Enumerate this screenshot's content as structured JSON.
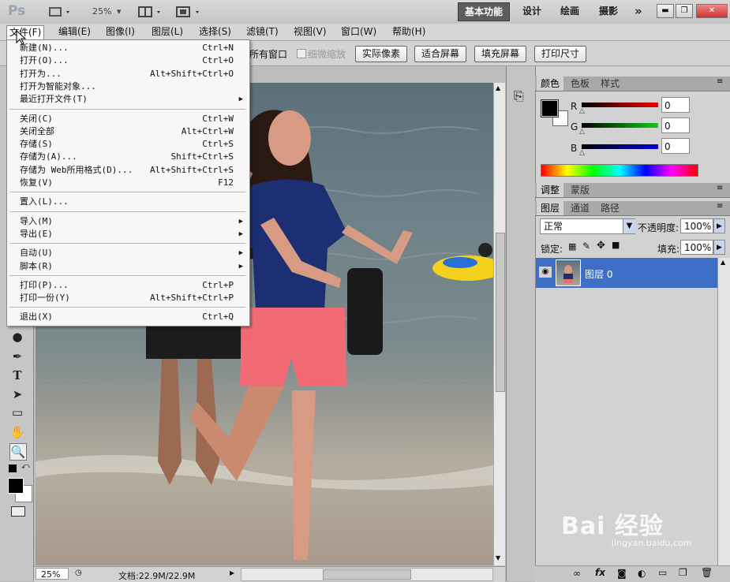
{
  "app": {
    "logo": "Ps",
    "zoom_label": "25%",
    "workspaces": [
      "基本功能",
      "设计",
      "绘画",
      "摄影"
    ],
    "more": "»"
  },
  "window_buttons": {
    "minimize": "▬",
    "restore": "❐",
    "close": "✕"
  },
  "menubar": [
    "文件(F)",
    "编辑(E)",
    "图像(I)",
    "图层(L)",
    "选择(S)",
    "滤镜(T)",
    "视图(V)",
    "窗口(W)",
    "帮助(H)"
  ],
  "options": {
    "all_windows": "所有窗口",
    "scrubby_zoom": "细微缩放",
    "buttons": [
      "实际像素",
      "适合屏幕",
      "填充屏幕",
      "打印尺寸"
    ]
  },
  "file_menu": [
    {
      "label": "新建(N)...",
      "shortcut": "Ctrl+N"
    },
    {
      "label": "打开(O)...",
      "shortcut": "Ctrl+O"
    },
    {
      "label": "打开为...",
      "shortcut": "Alt+Shift+Ctrl+O"
    },
    {
      "label": "打开为智能对象...",
      "shortcut": ""
    },
    {
      "label": "最近打开文件(T)",
      "shortcut": "",
      "submenu": true
    },
    {
      "sep": true
    },
    {
      "label": "关闭(C)",
      "shortcut": "Ctrl+W"
    },
    {
      "label": "关闭全部",
      "shortcut": "Alt+Ctrl+W"
    },
    {
      "label": "存储(S)",
      "shortcut": "Ctrl+S"
    },
    {
      "label": "存储为(A)...",
      "shortcut": "Shift+Ctrl+S"
    },
    {
      "label": "存储为 Web所用格式(D)...",
      "shortcut": "Alt+Shift+Ctrl+S"
    },
    {
      "label": "恢复(V)",
      "shortcut": "F12"
    },
    {
      "sep": true
    },
    {
      "label": "置入(L)...",
      "shortcut": ""
    },
    {
      "sep": true
    },
    {
      "label": "导入(M)",
      "shortcut": "",
      "submenu": true
    },
    {
      "label": "导出(E)",
      "shortcut": "",
      "submenu": true
    },
    {
      "sep": true
    },
    {
      "label": "自动(U)",
      "shortcut": "",
      "submenu": true
    },
    {
      "label": "脚本(R)",
      "shortcut": "",
      "submenu": true
    },
    {
      "sep": true
    },
    {
      "label": "打印(P)...",
      "shortcut": "Ctrl+P"
    },
    {
      "label": "打印一份(Y)",
      "shortcut": "Alt+Shift+Ctrl+P"
    },
    {
      "sep": true
    },
    {
      "label": "退出(X)",
      "shortcut": "Ctrl+Q"
    }
  ],
  "color_panel": {
    "tabs": [
      "颜色",
      "色板",
      "样式"
    ],
    "channels": [
      {
        "label": "R",
        "value": "0",
        "color": "#cc0000"
      },
      {
        "label": "G",
        "value": "0",
        "color": "#22b022"
      },
      {
        "label": "B",
        "value": "0",
        "color": "#0000cc"
      }
    ]
  },
  "adjust_panel": {
    "tabs": [
      "调整",
      "蒙版"
    ]
  },
  "layers_panel": {
    "tabs": [
      "图层",
      "通道",
      "路径"
    ],
    "blend_mode": "正常",
    "opacity_label": "不透明度:",
    "opacity_value": "100%",
    "lock_label": "锁定:",
    "fill_label": "填充:",
    "fill_value": "100%",
    "layer_name": "图层 0"
  },
  "status": {
    "zoom": "25%",
    "doc_info": "文档:22.9M/22.9M"
  },
  "watermark": {
    "brand": "Bai 经验",
    "url": "jingyan.baidu.com"
  }
}
